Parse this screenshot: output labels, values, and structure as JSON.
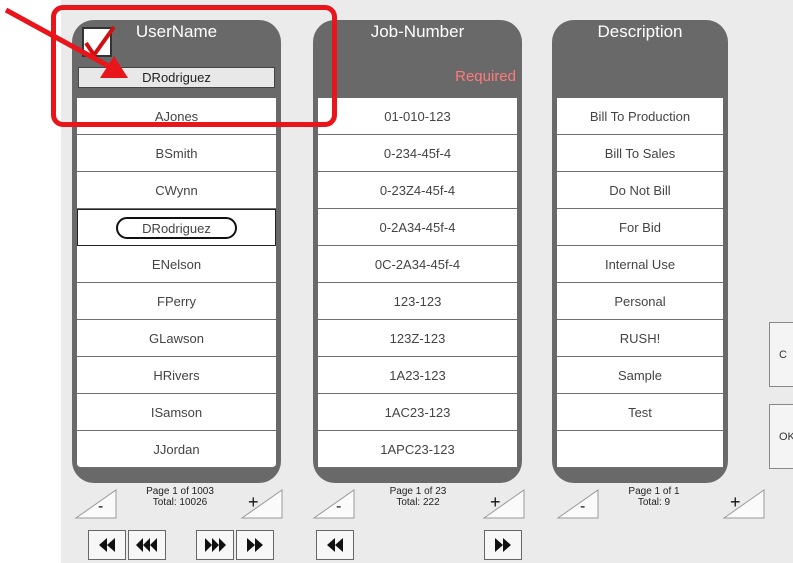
{
  "colors": {
    "column_bg": "#696969",
    "required_text": "#ff7a7a",
    "annotation": "#e8161b",
    "checkmark": "#d01010"
  },
  "username": {
    "header": "UserName",
    "selected": "DRodriguez",
    "rows": [
      "AJones",
      "BSmith",
      "CWynn",
      "DRodriguez",
      "ENelson",
      "FPerry",
      "GLawson",
      "HRivers",
      "ISamson",
      "JJordan"
    ],
    "pager": {
      "line1": "Page 1 of 1003",
      "line2": "Total: 10026"
    }
  },
  "job": {
    "header": "Job-Number",
    "required": "Required",
    "rows": [
      "01-010-123",
      "0-234-45f-4",
      "0-23Z4-45f-4",
      "0-2A34-45f-4",
      "0C-2A34-45f-4",
      "123-123",
      "123Z-123",
      "1A23-123",
      "1AC23-123",
      "1APC23-123"
    ],
    "pager": {
      "line1": "Page 1 of 23",
      "line2": "Total: 222"
    }
  },
  "description": {
    "header": "Description",
    "rows": [
      "Bill To Production",
      "Bill To Sales",
      "Do Not Bill",
      "For Bid",
      "Internal Use",
      "Personal",
      "RUSH!",
      "Sample",
      "Test",
      ""
    ],
    "pager": {
      "line1": "Page 1 of 1",
      "line2": "Total: 9"
    }
  },
  "buttons": {
    "minus": "-",
    "plus": "+",
    "clear": "C",
    "ok": "OK"
  }
}
